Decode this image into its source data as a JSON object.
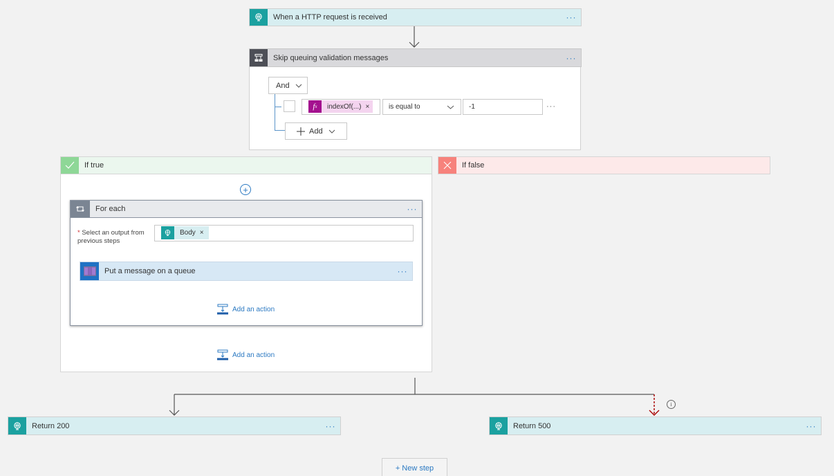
{
  "trigger": {
    "title": "When a HTTP request is received",
    "icon": "http-globe-icon",
    "more": "···"
  },
  "condition": {
    "title": "Skip queuing validation messages",
    "icon": "condition-icon",
    "more": "···",
    "group_operator": "And",
    "rows": [
      {
        "token_label": "indexOf(...)",
        "token_icon": "fx",
        "token_remove": "×",
        "operator": "is equal to",
        "value": "-1",
        "more": "···"
      }
    ],
    "add_label": "Add"
  },
  "branches": {
    "true": {
      "label": "If true",
      "icon": "check-icon",
      "insert_symbol": "+",
      "foreach": {
        "title": "For each",
        "more": "···",
        "required_marker": "*",
        "select_label": "Select an output from previous steps",
        "token": {
          "label": "Body",
          "remove": "×"
        },
        "action": {
          "title": "Put a message on a queue",
          "more": "···"
        },
        "add_action_label": "Add an action"
      },
      "add_action_label": "Add an action"
    },
    "false": {
      "label": "If false",
      "icon": "x-icon"
    }
  },
  "returns": [
    {
      "title": "Return 200",
      "more": "···"
    },
    {
      "title": "Return 500",
      "more": "···"
    }
  ],
  "info_symbol": "i",
  "new_step_label": "+ New step",
  "colors": {
    "canvas": "#f2f2f2",
    "http_teal": "#1ba1a0",
    "http_header": "#d7eef1",
    "condition_header": "#d9d9dc",
    "true_green": "#8ed797",
    "false_red": "#f7827c",
    "link_blue": "#2b79c2",
    "fx_magenta": "#a4118f",
    "run_after_failed": "#a80000"
  }
}
